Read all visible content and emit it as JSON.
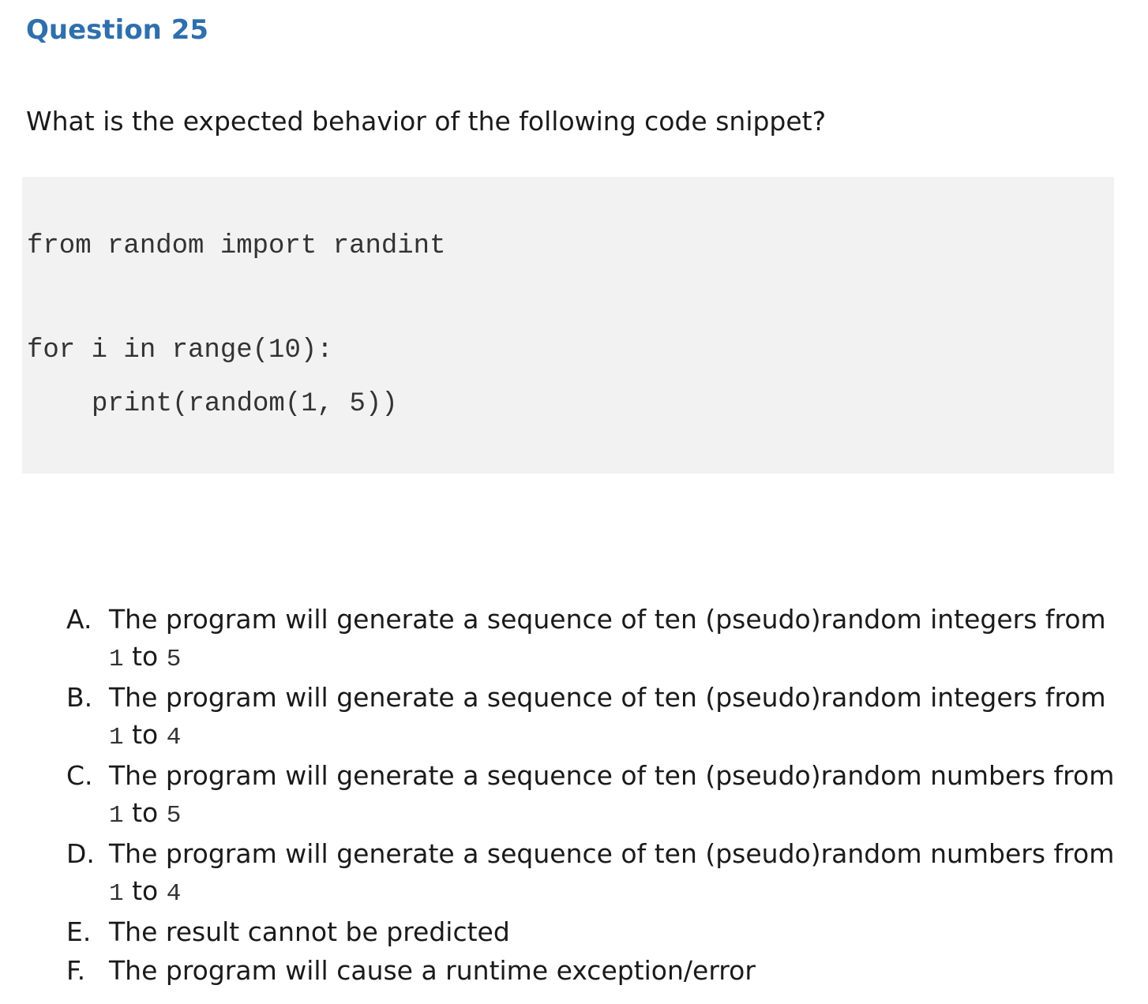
{
  "question": {
    "title": "Question 25",
    "prompt": "What is the expected behavior of the following code snippet?"
  },
  "code": {
    "lines": [
      "from random import randint",
      "for i in range(10):",
      "print(random(1, 5))"
    ]
  },
  "options": [
    {
      "letter": "A.",
      "text_before": "The program will generate a sequence of ten (pseudo)random integers from ",
      "code_start": "1",
      "text_middle": " to ",
      "code_end": "5"
    },
    {
      "letter": "B.",
      "text_before": "The program will generate a sequence of ten (pseudo)random integers from ",
      "code_start": "1",
      "text_middle": " to ",
      "code_end": "4"
    },
    {
      "letter": "C.",
      "text_before": "The program will generate a sequence of ten (pseudo)random numbers from ",
      "code_start": "1",
      "text_middle": " to ",
      "code_end": "5"
    },
    {
      "letter": "D.",
      "text_before": "The program will generate a sequence of ten (pseudo)random numbers from ",
      "code_start": "1",
      "text_middle": " to ",
      "code_end": "4"
    },
    {
      "letter": "E.",
      "text": "The result cannot be predicted"
    },
    {
      "letter": "F.",
      "text": "The program will cause a runtime exception/error"
    }
  ]
}
